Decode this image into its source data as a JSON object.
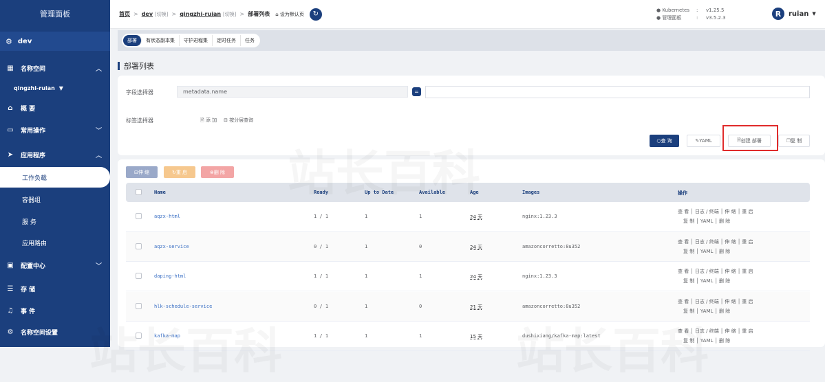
{
  "sidebar": {
    "title": "管理面板",
    "cluster": "dev",
    "namespace_section": "名称空间",
    "namespace_value": "qingzhi-ruian",
    "items": [
      {
        "label": "概 要"
      },
      {
        "label": "常用操作"
      },
      {
        "label": "应用程序"
      },
      {
        "label": "工作负载"
      },
      {
        "label": "容器组"
      },
      {
        "label": "服 务"
      },
      {
        "label": "应用路由"
      },
      {
        "label": "配置中心"
      },
      {
        "label": "存 储"
      },
      {
        "label": "事 件"
      },
      {
        "label": "名称空间设置"
      }
    ]
  },
  "topbar": {
    "crumb_home": "首页",
    "crumb_cluster": "dev",
    "cluster_tag": "[切换]",
    "crumb_ns": "qingzhi-ruian",
    "ns_tag": "[切换]",
    "current": "部署列表",
    "set_default": "设为默认页",
    "versions": [
      {
        "key": "Kubernetes",
        "value": "v1.25.5"
      },
      {
        "key": "管理面板",
        "value": "v3.5.2.3"
      }
    ],
    "user": "ruian",
    "avatar_letter": "R"
  },
  "tabs": [
    "部署",
    "有状态副本集",
    "守护进程集",
    "定时任务",
    "任务"
  ],
  "page_title": "部署列表",
  "filters": {
    "field_label": "字段选择器",
    "field_select": "metadata.name",
    "operator": "=",
    "label_label": "标签选择器",
    "add": "添 加",
    "group_query": "按分层查询",
    "query_btn": "查 询",
    "yaml_btn": "YAML",
    "create_btn": "创建 部署",
    "copy_btn": "复 制"
  },
  "bulk": {
    "scale": "伸 缩",
    "restart": "重 启",
    "delete": "删 除"
  },
  "table": {
    "headers": [
      "Name",
      "Ready",
      "Up to Date",
      "Available",
      "Age",
      "Images",
      "操作"
    ],
    "rows": [
      {
        "name": "aqzx-html",
        "ready": "1 / 1",
        "uptodate": "1",
        "available": "1",
        "age": "24 天",
        "image": "nginx:1.23.3"
      },
      {
        "name": "aqzx-service",
        "ready": "0 / 1",
        "uptodate": "1",
        "available": "0",
        "age": "24 天",
        "image": "amazoncorretto:8u352"
      },
      {
        "name": "daping-html",
        "ready": "1 / 1",
        "uptodate": "1",
        "available": "1",
        "age": "24 天",
        "image": "nginx:1.23.3"
      },
      {
        "name": "hlk-schedule-service",
        "ready": "0 / 1",
        "uptodate": "1",
        "available": "0",
        "age": "21 天",
        "image": "amazoncorretto:8u352"
      },
      {
        "name": "kafka-map",
        "ready": "1 / 1",
        "uptodate": "1",
        "available": "1",
        "age": "15 天",
        "image": "dushixiang/kafka-map:latest"
      }
    ],
    "ops_line1": "查 看 │ 日志 / 终端 │ 伸 缩 │ 重 启",
    "ops_line2": "复 制 │ YAML │ 删 除"
  },
  "watermark": "站长百科"
}
